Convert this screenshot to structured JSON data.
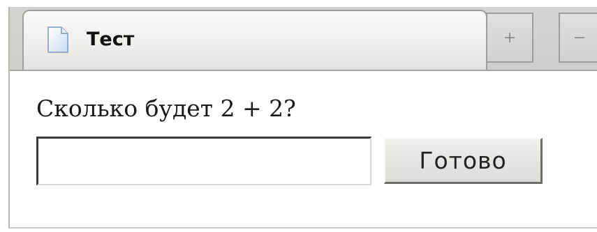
{
  "tab": {
    "title": "Тест",
    "icon": "document-icon",
    "add_symbol": "+",
    "minimize_symbol": "−"
  },
  "form": {
    "question": "Сколько будет 2 + 2?",
    "answer_value": "",
    "answer_placeholder": "",
    "submit_label": "Готово"
  }
}
